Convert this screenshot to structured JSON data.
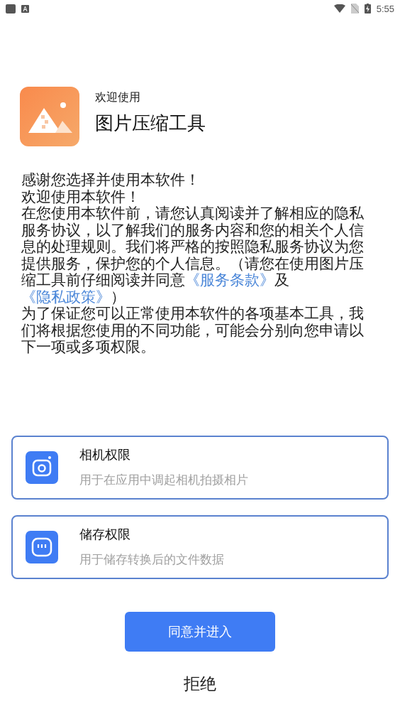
{
  "status_bar": {
    "time": "5:55"
  },
  "header": {
    "subtitle": "欢迎使用",
    "title": "图片压缩工具"
  },
  "intro": {
    "lines": [
      "感谢您选择并使用本软件！",
      "欢迎使用本软件！"
    ],
    "policy": [
      {
        "kind": "text",
        "text": "在您使用本软件前，请您认真阅读并了解相应的隐私服务协议，以了解我们的服务内容和您的相关个人信息的处理规则。我们将严格的按照隐私服务协议为您提供服务，保护您的个人信息。（请您在使用图片压缩工具前仔细阅读并同意"
      },
      {
        "kind": "link",
        "text": "《服务条款》"
      },
      {
        "kind": "text",
        "text": "及"
      },
      {
        "kind": "link",
        "text": "《隐私政策》"
      },
      {
        "kind": "text",
        "text": "）"
      }
    ],
    "closing": "为了保证您可以正常使用本软件的各项基本工具，我们将根据您使用的不同功能，可能会分别向您申请以下一项或多项权限。"
  },
  "permissions": [
    {
      "kind": "camera",
      "title": "相机权限",
      "description": "用于在应用中调起相机拍摄相片"
    },
    {
      "kind": "storage",
      "title": "储存权限",
      "description": "用于储存转换后的文件数据"
    }
  ],
  "agree_button": "同意并进入",
  "decline_button": "拒绝"
}
